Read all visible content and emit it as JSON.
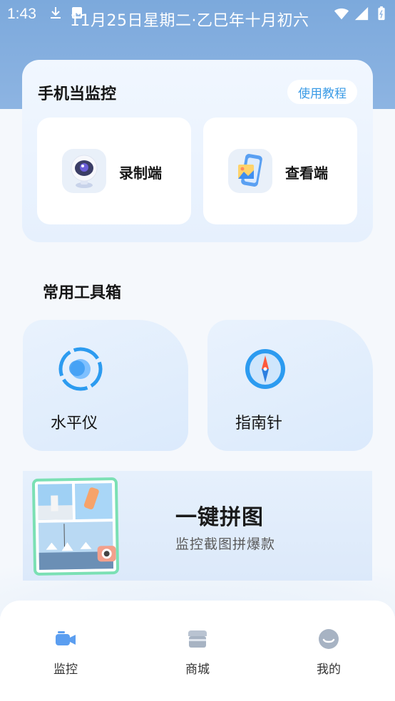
{
  "status_bar": {
    "time": "1:43",
    "date": "11月25日星期二·乙巳年十月初六"
  },
  "monitor_card": {
    "title": "手机当监控",
    "tutorial_label": "使用教程",
    "modes": [
      {
        "label": "录制端",
        "icon": "camera-robot-icon"
      },
      {
        "label": "查看端",
        "icon": "phone-gallery-icon"
      }
    ]
  },
  "toolbox": {
    "title": "常用工具箱",
    "tools": [
      {
        "label": "水平仪",
        "icon": "spirit-level-icon"
      },
      {
        "label": "指南针",
        "icon": "compass-icon"
      }
    ]
  },
  "banner": {
    "title": "一键拼图",
    "subtitle": "监控截图拼爆款"
  },
  "bottom_nav": {
    "items": [
      {
        "label": "监控",
        "icon": "video-camera-icon",
        "active": true
      },
      {
        "label": "商城",
        "icon": "store-icon",
        "active": false
      },
      {
        "label": "我的",
        "icon": "user-face-icon",
        "active": false
      }
    ]
  },
  "colors": {
    "accent": "#3a9be6",
    "header_blue": "#7ca9dc",
    "tile_bg": "#e6f0fd",
    "collage_border": "#7be0b4"
  }
}
